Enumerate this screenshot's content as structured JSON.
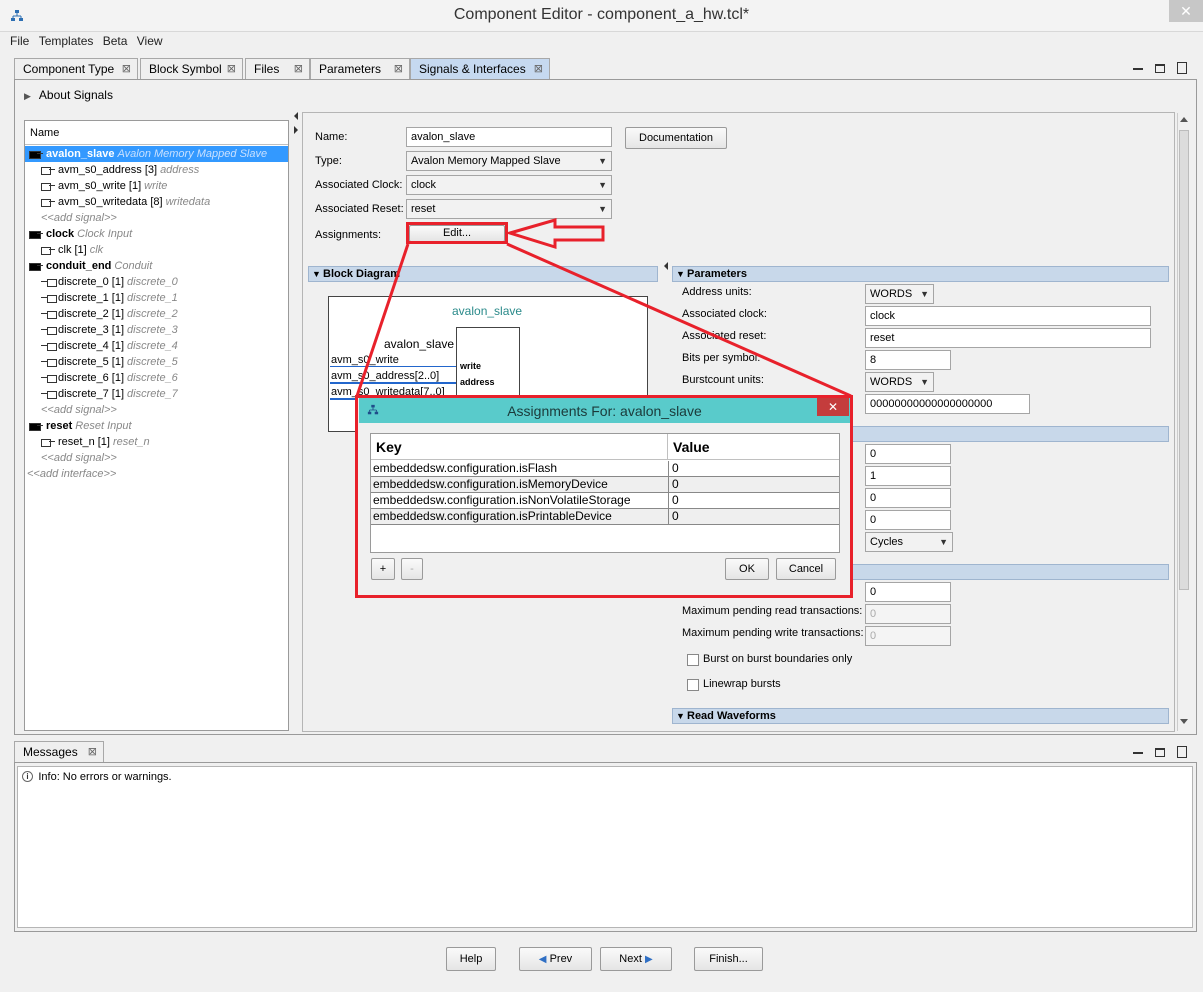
{
  "window": {
    "title": "Component Editor - component_a_hw.tcl*",
    "close": "✕"
  },
  "menu": [
    "File",
    "Templates",
    "Beta",
    "View"
  ],
  "tabs": [
    {
      "label": "Component Type"
    },
    {
      "label": "Block Symbol"
    },
    {
      "label": "Files"
    },
    {
      "label": "Parameters"
    },
    {
      "label": "Signals & Interfaces"
    }
  ],
  "tab_close": "⊠",
  "about_signals": "About Signals",
  "tree": {
    "header": "Name",
    "rows": [
      {
        "name": "avalon_slave",
        "type": "Avalon Memory Mapped Slave",
        "kind": "iface"
      },
      {
        "name": "avm_s0_address [3]",
        "type": "address",
        "kind": "signal"
      },
      {
        "name": "avm_s0_write [1]",
        "type": "write",
        "kind": "signal"
      },
      {
        "name": "avm_s0_writedata [8]",
        "type": "writedata",
        "kind": "signal"
      },
      {
        "name": "<<add signal>>",
        "kind": "add"
      },
      {
        "name": "clock",
        "type": "Clock Input",
        "kind": "iface"
      },
      {
        "name": "clk [1]",
        "type": "clk",
        "kind": "signal"
      },
      {
        "name": "conduit_end",
        "type": "Conduit",
        "kind": "iface"
      },
      {
        "name": "discrete_0 [1]",
        "type": "discrete_0",
        "kind": "conduit"
      },
      {
        "name": "discrete_1 [1]",
        "type": "discrete_1",
        "kind": "conduit"
      },
      {
        "name": "discrete_2 [1]",
        "type": "discrete_2",
        "kind": "conduit"
      },
      {
        "name": "discrete_3 [1]",
        "type": "discrete_3",
        "kind": "conduit"
      },
      {
        "name": "discrete_4 [1]",
        "type": "discrete_4",
        "kind": "conduit"
      },
      {
        "name": "discrete_5 [1]",
        "type": "discrete_5",
        "kind": "conduit"
      },
      {
        "name": "discrete_6 [1]",
        "type": "discrete_6",
        "kind": "conduit"
      },
      {
        "name": "discrete_7 [1]",
        "type": "discrete_7",
        "kind": "conduit"
      },
      {
        "name": "<<add signal>>",
        "kind": "add"
      },
      {
        "name": "reset",
        "type": "Reset Input",
        "kind": "iface"
      },
      {
        "name": "reset_n [1]",
        "type": "reset_n",
        "kind": "signal"
      },
      {
        "name": "<<add signal>>",
        "kind": "add"
      },
      {
        "name": "<<add interface>>",
        "kind": "addiface"
      }
    ]
  },
  "form": {
    "name_label": "Name:",
    "name_value": "avalon_slave",
    "documentation": "Documentation",
    "type_label": "Type:",
    "type_value": "Avalon Memory Mapped Slave",
    "clock_label": "Associated Clock:",
    "clock_value": "clock",
    "reset_label": "Associated Reset:",
    "reset_value": "reset",
    "assign_label": "Assignments:",
    "edit_button": "Edit..."
  },
  "block_diagram": {
    "header": "Block Diagram",
    "title": "avalon_slave",
    "subtitle": "avalon_slave",
    "ports": [
      "avm_s0_write",
      "avm_s0_address[2..0]",
      "avm_s0_writedata[7..0]"
    ],
    "inner_ports": [
      "write",
      "address"
    ]
  },
  "parameters": {
    "header": "Parameters",
    "address_units_label": "Address units:",
    "address_units_value": "WORDS",
    "assoc_clock_label": "Associated clock:",
    "assoc_clock_value": "clock",
    "assoc_reset_label": "Associated reset:",
    "assoc_reset_value": "reset",
    "bits_label": "Bits per symbol:",
    "bits_value": "8",
    "burst_label": "Burstcount units:",
    "burst_value": "WORDS",
    "hex_value": "00000000000000000000",
    "v1": "0",
    "v2": "1",
    "v3": "0",
    "v4": "0",
    "cycles": "Cycles",
    "pending_value": "0",
    "max_read_label": "Maximum pending read transactions:",
    "max_read_value": "0",
    "max_write_label": "Maximum pending write transactions:",
    "max_write_value": "0",
    "burst_boundaries": "Burst on burst boundaries only",
    "linewrap": "Linewrap bursts",
    "read_waveforms": "Read Waveforms"
  },
  "dialog": {
    "title": "Assignments For: avalon_slave",
    "close": "✕",
    "key_header": "Key",
    "value_header": "Value",
    "rows": [
      {
        "key": "embeddedsw.configuration.isFlash",
        "value": "0"
      },
      {
        "key": "embeddedsw.configuration.isMemoryDevice",
        "value": "0"
      },
      {
        "key": "embeddedsw.configuration.isNonVolatileStorage",
        "value": "0"
      },
      {
        "key": "embeddedsw.configuration.isPrintableDevice",
        "value": "0"
      }
    ],
    "add": "+",
    "remove": "-",
    "ok": "OK",
    "cancel": "Cancel"
  },
  "messages": {
    "tab": "Messages",
    "info": "Info: No errors or warnings."
  },
  "wizard": {
    "help": "Help",
    "prev": "Prev",
    "next": "Next",
    "finish": "Finish..."
  },
  "colors": {
    "highlight": "#e8212b",
    "selection": "#3399ff",
    "dialog_title": "#59cbcb",
    "section_header": "#c8d8ea"
  }
}
